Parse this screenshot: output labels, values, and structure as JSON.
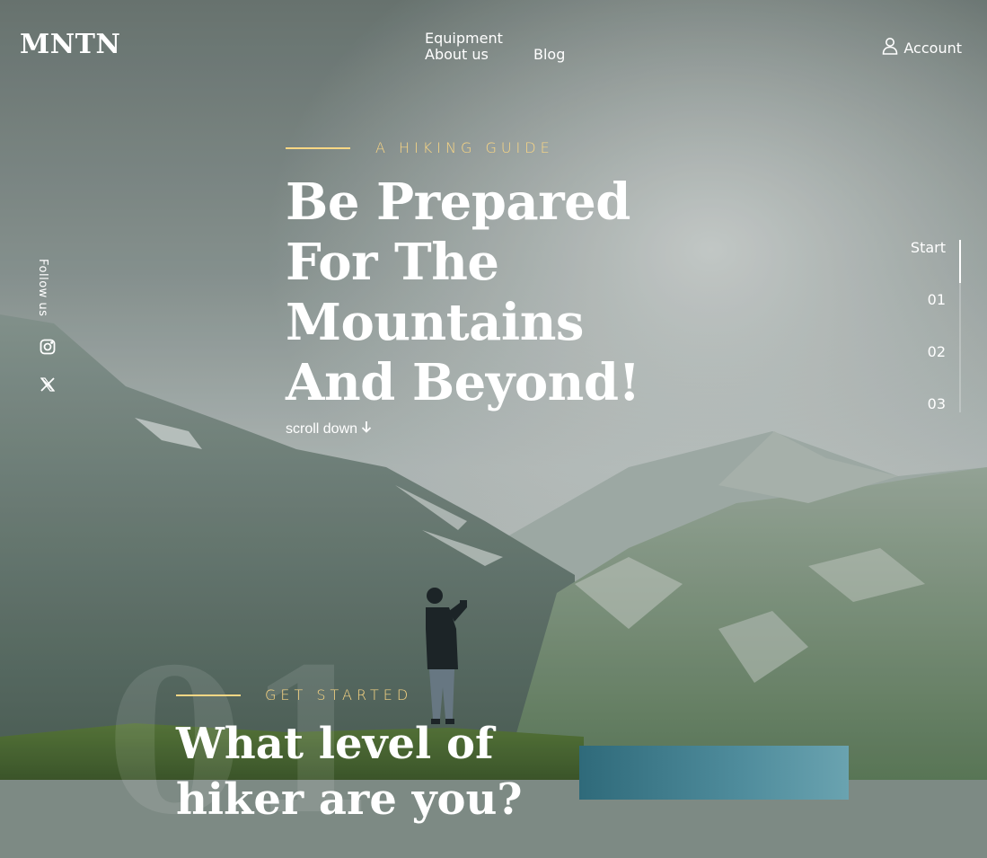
{
  "brand": {
    "logo": "MNTN"
  },
  "nav": {
    "items": [
      {
        "label": "Equipment"
      },
      {
        "label": "About us"
      },
      {
        "label": "Blog"
      }
    ],
    "account_label": "Account"
  },
  "social": {
    "follow_label": "Follow us",
    "icons": [
      "instagram-icon",
      "x-twitter-icon"
    ]
  },
  "hero": {
    "eyebrow": "A HIKING GUIDE",
    "title": "Be Prepared For The Mountains And Beyond!",
    "scroll_label": "scroll down"
  },
  "pager": {
    "items": [
      "Start",
      "01",
      "02",
      "03"
    ],
    "active": "Start"
  },
  "section": {
    "number": "01",
    "eyebrow": "GET STARTED",
    "title": "What level of hiker are you?"
  },
  "colors": {
    "accent": "#fbd784",
    "text": "#ffffff"
  }
}
